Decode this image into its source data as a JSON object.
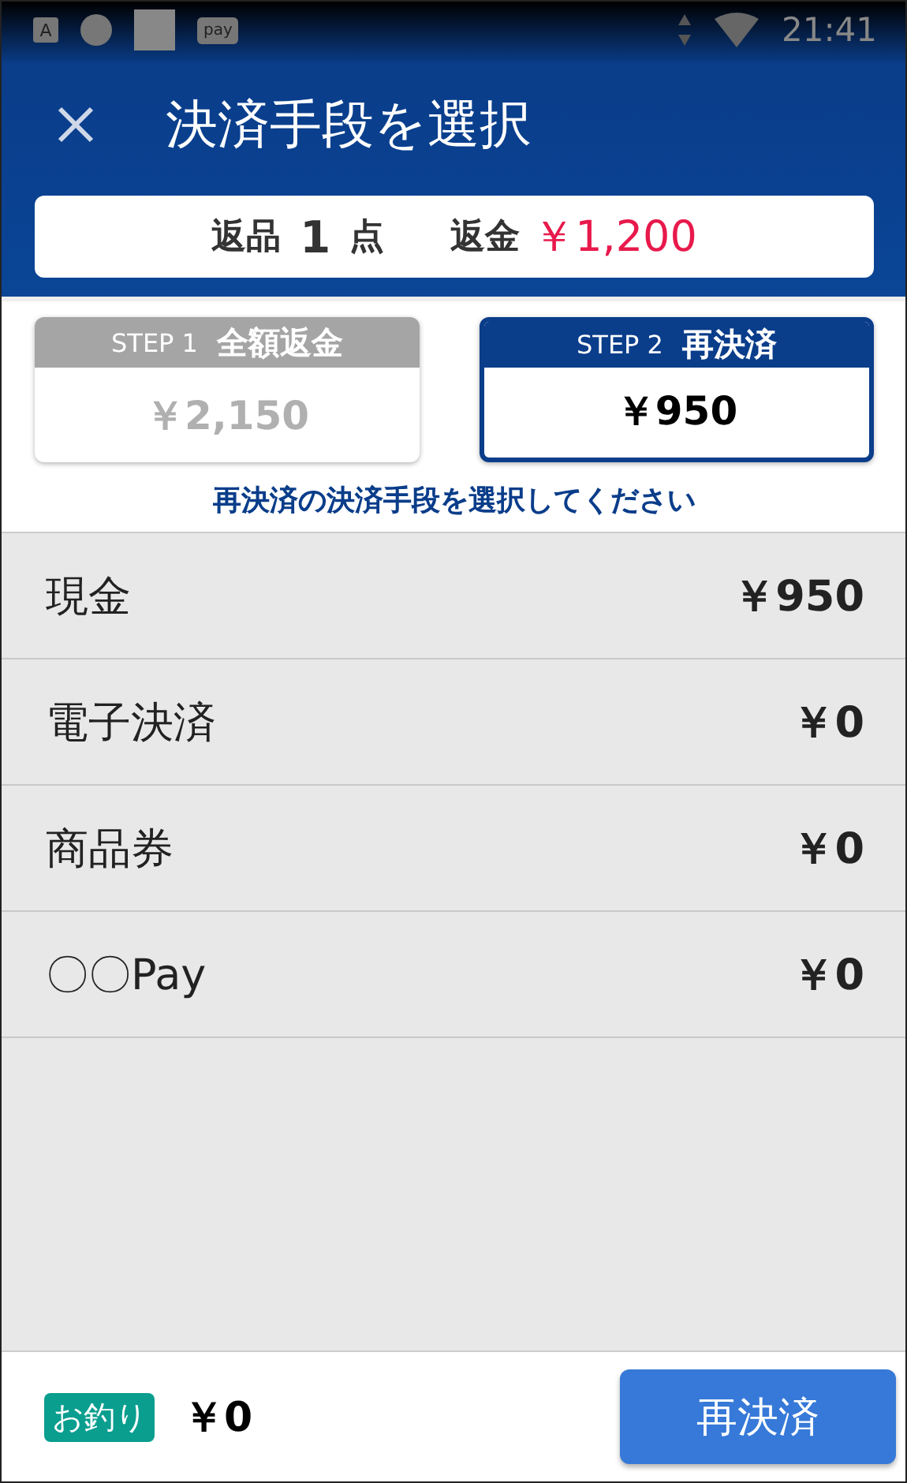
{
  "status_bar": {
    "icons": [
      {
        "kind": "letter",
        "label": "A"
      },
      {
        "kind": "circle"
      },
      {
        "kind": "square"
      },
      {
        "kind": "badge",
        "label": "pay"
      }
    ],
    "time": "21:41"
  },
  "app_bar": {
    "title": "決済手段を選択"
  },
  "summary": {
    "items_label": "返品",
    "items_count": "1",
    "items_unit": "点",
    "refund_label": "返金",
    "refund_amount": "￥1,200"
  },
  "steps": [
    {
      "step": "STEP 1",
      "title": "全額返金",
      "amount": "￥2,150",
      "selected": false
    },
    {
      "step": "STEP 2",
      "title": "再決済",
      "amount": "￥950",
      "selected": true
    }
  ],
  "instruction": "再決済の決済手段を選択してください",
  "methods": [
    {
      "name": "現金",
      "amount": "￥950"
    },
    {
      "name": "電子決済",
      "amount": "￥0"
    },
    {
      "name": "商品券",
      "amount": "￥0"
    },
    {
      "name": "〇〇Pay",
      "amount": "￥0"
    }
  ],
  "footer": {
    "change_label": "お釣り",
    "change_amount": "￥0",
    "button": "再決済"
  }
}
